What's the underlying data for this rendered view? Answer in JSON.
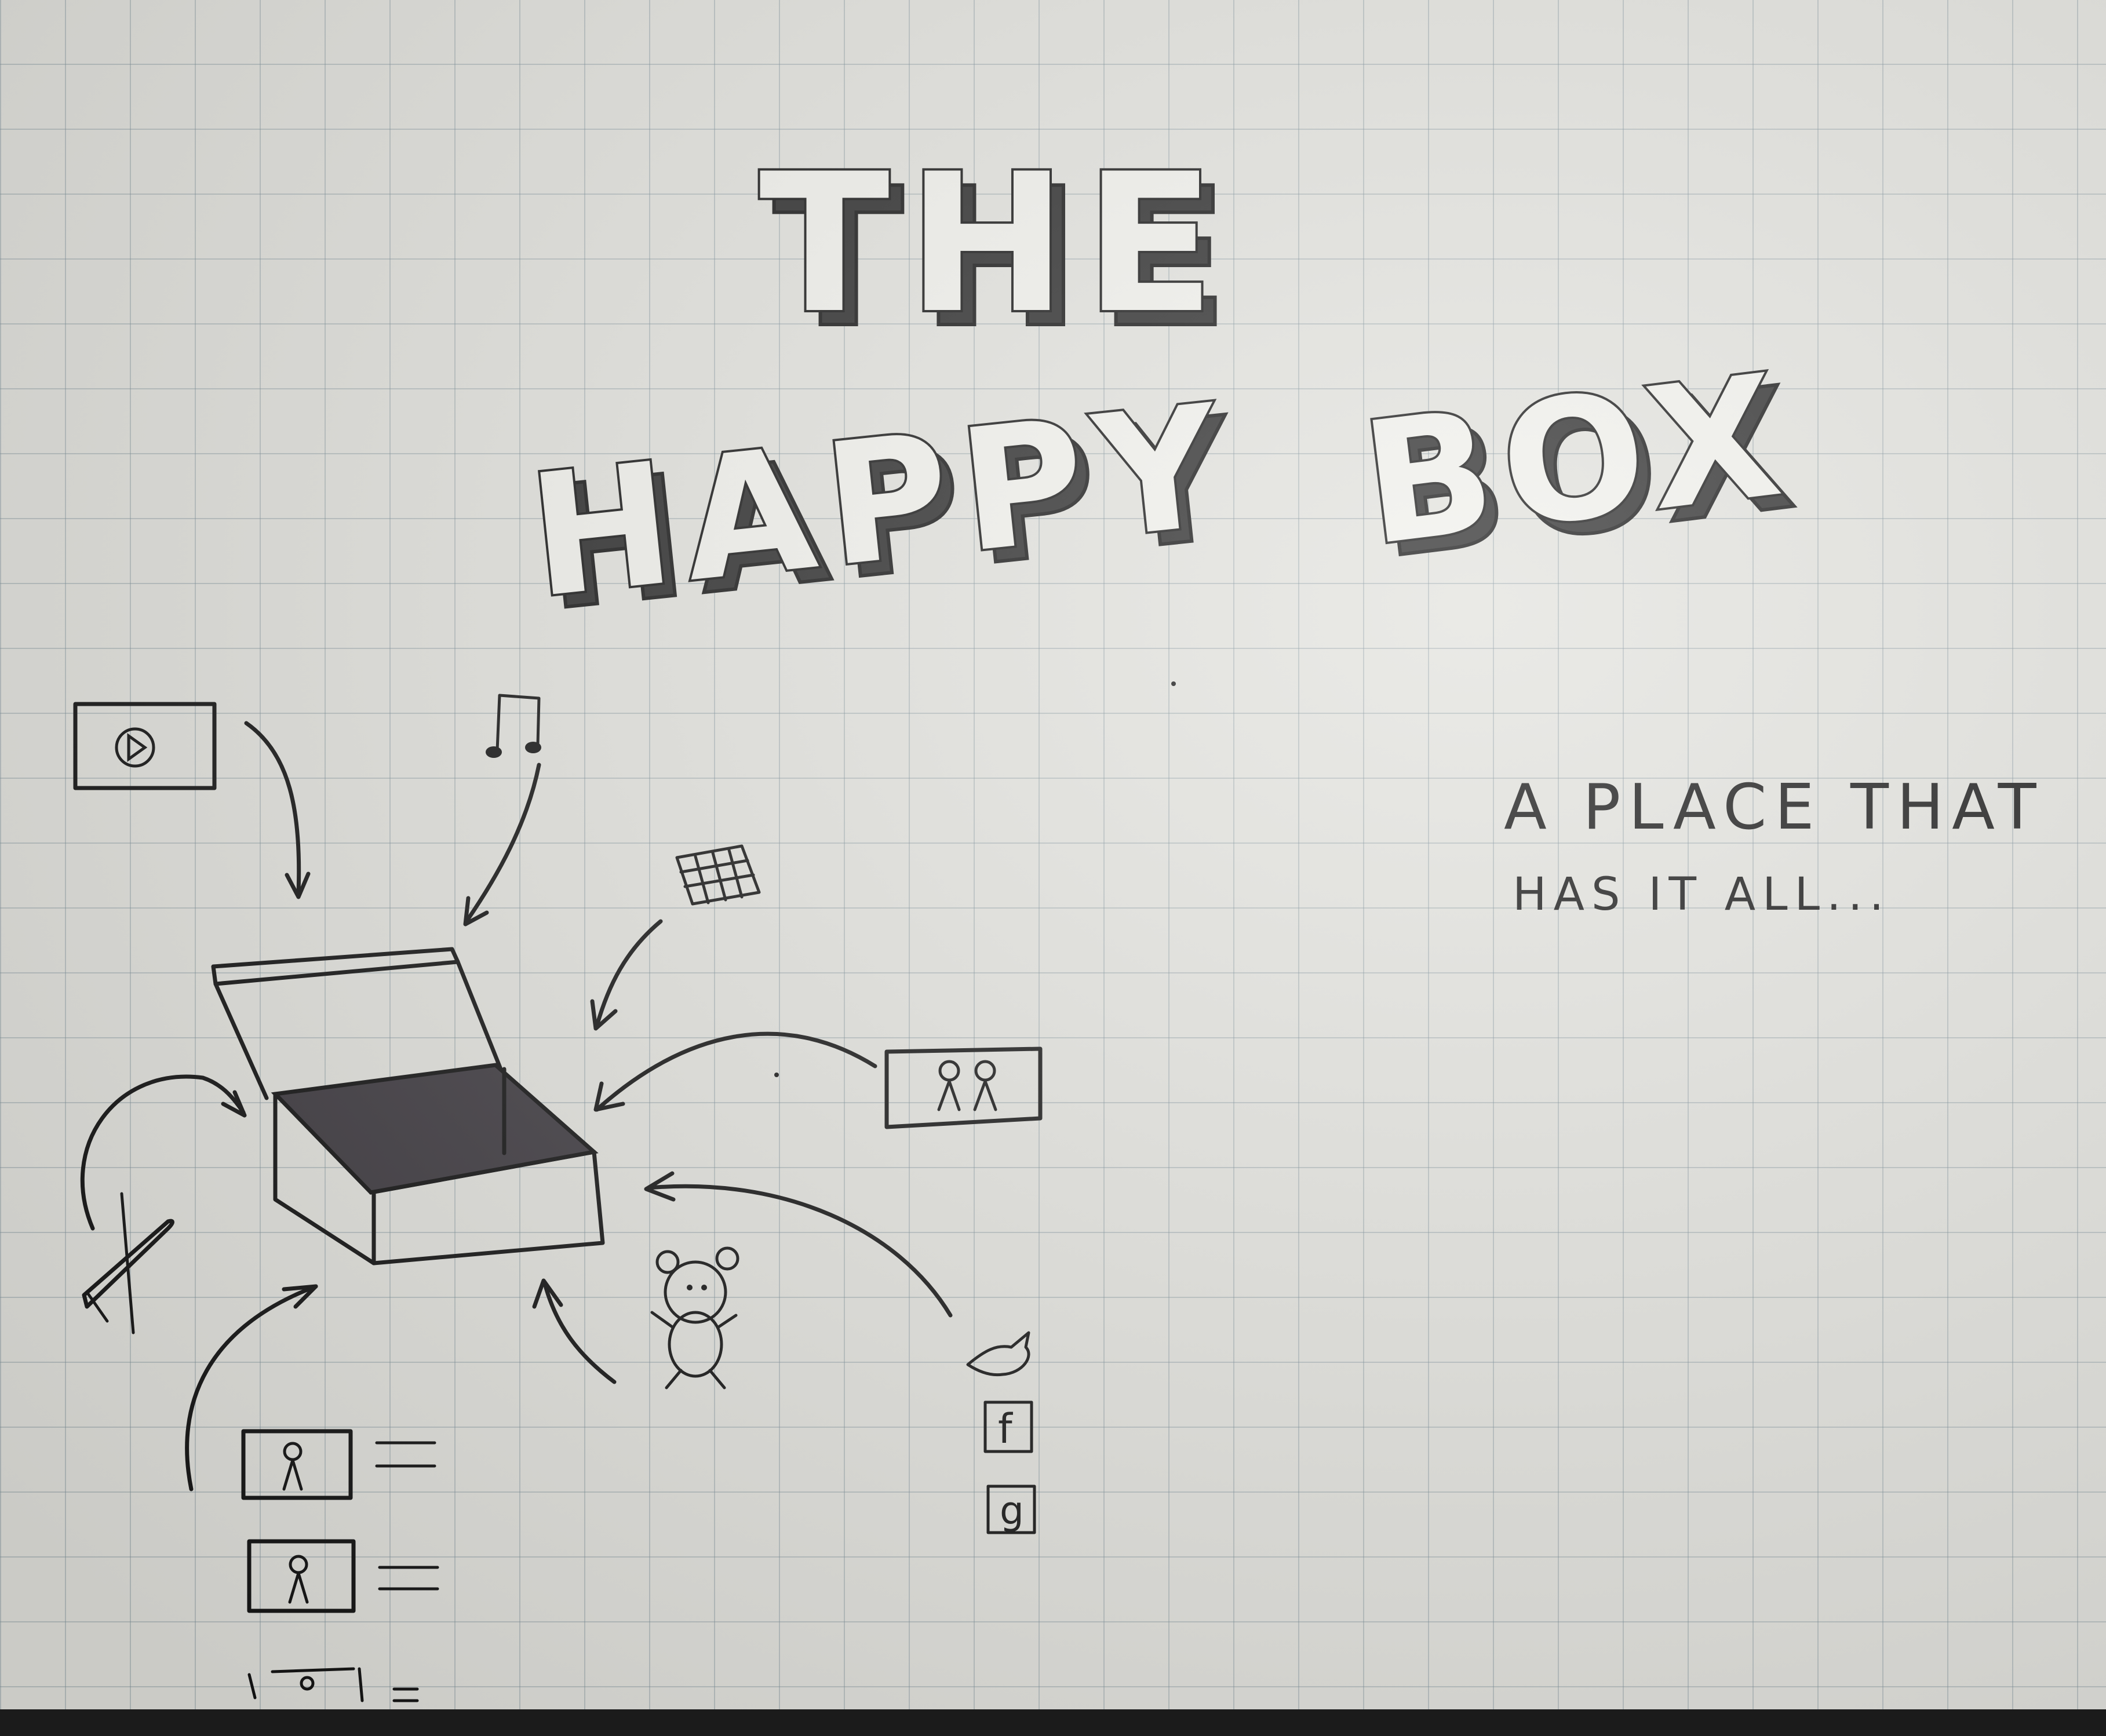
{
  "title": {
    "line1": "THE",
    "line2_word1": "HAPPY",
    "line2_word2": "BOX"
  },
  "tagline": {
    "line1": "A PLACE THAT",
    "line2": "HAS IT ALL..."
  },
  "icons": {
    "video": "video-play-icon",
    "music": "music-note-icon",
    "calendar": "calendar-icon",
    "people": "people-photo-icon",
    "airplane": "airplane-icon",
    "profiles": "profile-list-icon",
    "teddy": "teddy-bear-icon",
    "twitter": "twitter-bird-icon",
    "facebook": "facebook-icon",
    "google": "google-icon",
    "box": "open-box-icon"
  },
  "social_letters": {
    "facebook": "f",
    "google": "g"
  },
  "colors": {
    "ink": "#141414",
    "paper": "#e2e2dd",
    "grid": "#8c9aa0"
  }
}
